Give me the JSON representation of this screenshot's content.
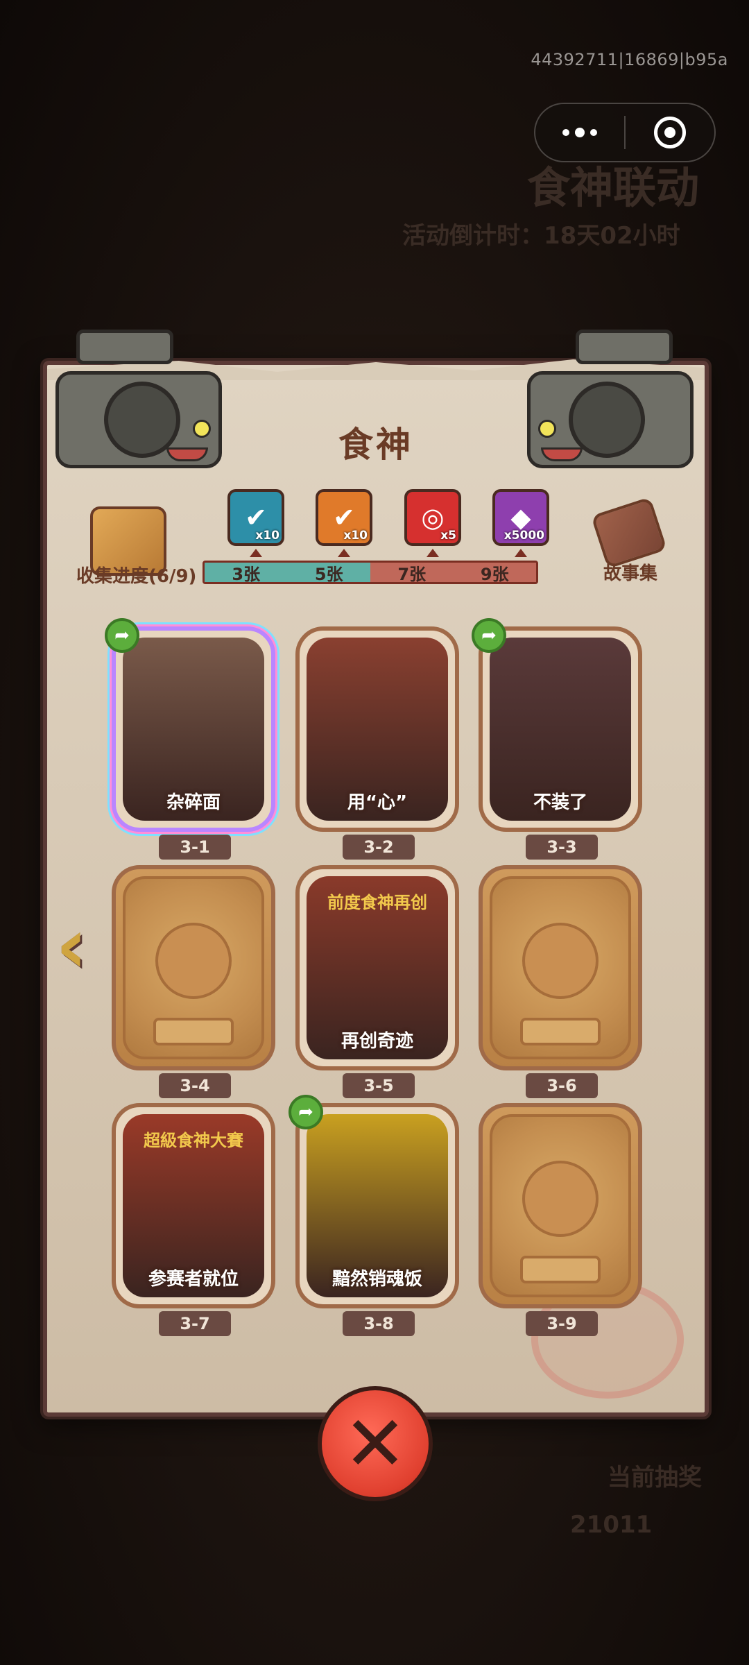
{
  "build_id": "44392711|16869|b95a",
  "capsule": {
    "more_icon": "more-dots-icon",
    "close_icon": "target-circle-icon"
  },
  "background": {
    "event_title": "食神联动",
    "countdown": "活动倒计时：18天02小时",
    "bottom_label": "当前抽奖",
    "coin_value": "21011"
  },
  "panel": {
    "title": "食神",
    "collection_progress": "收集进度(6/9)",
    "story_label": "故事集"
  },
  "rewards": [
    {
      "icon": "green-check-card-icon",
      "qty": "x10",
      "color": "#2d8fa8"
    },
    {
      "icon": "orange-check-card-icon",
      "qty": "x10",
      "color": "#e07a2a"
    },
    {
      "icon": "purple-disc-icon",
      "qty": "x5",
      "color": "#d6302f"
    },
    {
      "icon": "crystal-icon",
      "qty": "x5000",
      "color": "#8e3fae"
    }
  ],
  "milestones": [
    "3张",
    "5张",
    "7张",
    "9张"
  ],
  "milestone_colors": [
    "#5fb0a5",
    "#5fb0a5",
    "#c0685a",
    "#c0685a"
  ],
  "cards": [
    {
      "id": "3-1",
      "title": "杂碎面",
      "unlocked": true,
      "shared": true,
      "holo": true,
      "color": "#7a5a4a"
    },
    {
      "id": "3-2",
      "title": "用“心”",
      "unlocked": true,
      "shared": false,
      "holo": false,
      "color": "#8a4030"
    },
    {
      "id": "3-3",
      "title": "不装了",
      "unlocked": true,
      "shared": true,
      "holo": false,
      "color": "#5a3a3a"
    },
    {
      "id": "3-4",
      "title": "",
      "unlocked": false,
      "shared": false,
      "holo": false,
      "color": ""
    },
    {
      "id": "3-5",
      "title": "再创奇迹",
      "unlocked": true,
      "shared": false,
      "holo": false,
      "color": "#8a3a2a"
    },
    {
      "id": "3-6",
      "title": "",
      "unlocked": false,
      "shared": false,
      "holo": false,
      "color": ""
    },
    {
      "id": "3-7",
      "title": "参赛者就位",
      "unlocked": true,
      "shared": false,
      "holo": false,
      "color": "#9a3a28"
    },
    {
      "id": "3-8",
      "title": "黯然销魂饭",
      "unlocked": true,
      "shared": true,
      "holo": false,
      "color": "#c9a020"
    },
    {
      "id": "3-9",
      "title": "",
      "unlocked": false,
      "shared": false,
      "holo": false,
      "color": ""
    }
  ],
  "card_sub_texts": {
    "3-5": "前度食神再创",
    "3-7": "超級食神大賽"
  },
  "icons": {
    "prev": "chevron-left-icon",
    "close": "close-x-icon",
    "share": "share-arrow-icon"
  }
}
